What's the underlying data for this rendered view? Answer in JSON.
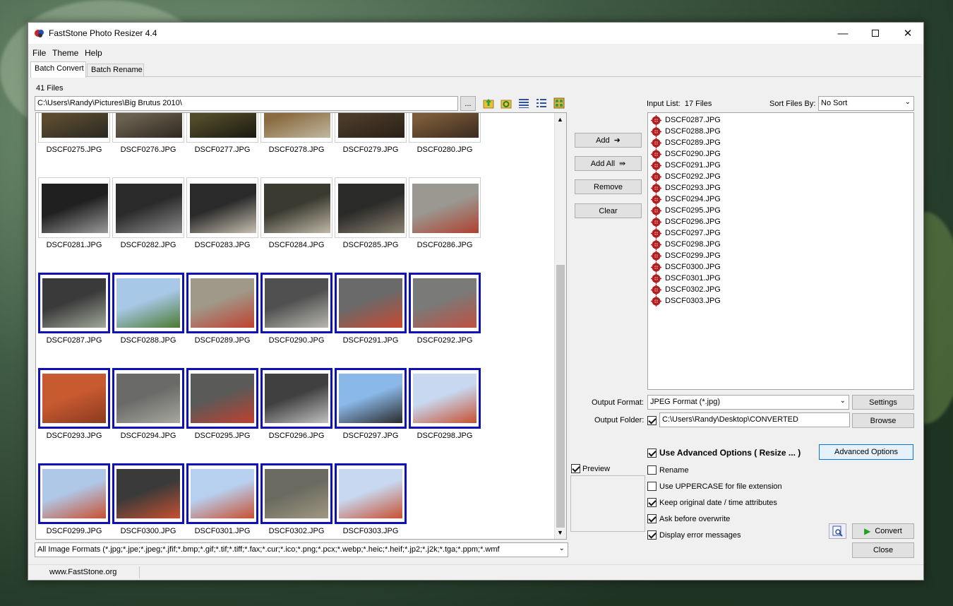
{
  "window": {
    "title": "FastStone Photo Resizer 4.4"
  },
  "menu": [
    "File",
    "Theme",
    "Help"
  ],
  "tabs": [
    "Batch Convert",
    "Batch Rename"
  ],
  "browser": {
    "file_count": "41 Files",
    "path": "C:\\Users\\Randy\\Pictures\\Big Brutus 2010\\",
    "browse_label": "...",
    "filter": "All Image Formats (*.jpg;*.jpe;*.jpeg;*.jfif;*.bmp;*.gif;*.tif;*.tiff;*.fax;*.cur;*.ico;*.png;*.pcx;*.webp;*.heic;*.heif;*.jp2;*.j2k;*.tga;*.ppm;*.wmf"
  },
  "thumbnails": [
    {
      "name": "DSCF0275.JPG",
      "selected": false,
      "colors": [
        "#5a4a30",
        "#2a2a20"
      ]
    },
    {
      "name": "DSCF0276.JPG",
      "selected": false,
      "colors": [
        "#6a6050",
        "#302820"
      ]
    },
    {
      "name": "DSCF0277.JPG",
      "selected": false,
      "colors": [
        "#504a2a",
        "#1a1a10"
      ]
    },
    {
      "name": "DSCF0278.JPG",
      "selected": false,
      "colors": [
        "#8a6a40",
        "#c0b8a0"
      ]
    },
    {
      "name": "DSCF0279.JPG",
      "selected": false,
      "colors": [
        "#4a3a28",
        "#2a2018"
      ]
    },
    {
      "name": "DSCF0280.JPG",
      "selected": false,
      "colors": [
        "#7a5a38",
        "#3a2a20"
      ]
    },
    {
      "name": "DSCF0281.JPG",
      "selected": false,
      "colors": [
        "#202020",
        "#9a9a9a"
      ]
    },
    {
      "name": "DSCF0282.JPG",
      "selected": false,
      "colors": [
        "#2a2a2a",
        "#8a8a8a"
      ]
    },
    {
      "name": "DSCF0283.JPG",
      "selected": false,
      "colors": [
        "#2a2a2a",
        "#c8c0b0"
      ]
    },
    {
      "name": "DSCF0284.JPG",
      "selected": false,
      "colors": [
        "#3a3a30",
        "#c0b8a8"
      ]
    },
    {
      "name": "DSCF0285.JPG",
      "selected": false,
      "colors": [
        "#2a2a28",
        "#8a8070"
      ]
    },
    {
      "name": "DSCF0286.JPG",
      "selected": false,
      "colors": [
        "#9a9890",
        "#b04030"
      ]
    },
    {
      "name": "DSCF0287.JPG",
      "selected": true,
      "colors": [
        "#3a3a3a",
        "#a0a898"
      ]
    },
    {
      "name": "DSCF0288.JPG",
      "selected": true,
      "colors": [
        "#a8c8e8",
        "#4a7a30"
      ]
    },
    {
      "name": "DSCF0289.JPG",
      "selected": true,
      "colors": [
        "#a09888",
        "#c04030"
      ]
    },
    {
      "name": "DSCF0290.JPG",
      "selected": true,
      "colors": [
        "#505050",
        "#b8b8b0"
      ]
    },
    {
      "name": "DSCF0291.JPG",
      "selected": true,
      "colors": [
        "#6a6a6a",
        "#c84830"
      ]
    },
    {
      "name": "DSCF0292.JPG",
      "selected": true,
      "colors": [
        "#7a7a78",
        "#c05040"
      ]
    },
    {
      "name": "DSCF0293.JPG",
      "selected": true,
      "colors": [
        "#c85a30",
        "#8a3a20"
      ]
    },
    {
      "name": "DSCF0294.JPG",
      "selected": true,
      "colors": [
        "#6a6a68",
        "#a8a8a0"
      ]
    },
    {
      "name": "DSCF0295.JPG",
      "selected": true,
      "colors": [
        "#5a5a58",
        "#c04030"
      ]
    },
    {
      "name": "DSCF0296.JPG",
      "selected": true,
      "colors": [
        "#404040",
        "#c0c0c0"
      ]
    },
    {
      "name": "DSCF0297.JPG",
      "selected": true,
      "colors": [
        "#8ab8e8",
        "#2a2a2a"
      ]
    },
    {
      "name": "DSCF0298.JPG",
      "selected": true,
      "colors": [
        "#c8d8f0",
        "#c85030"
      ]
    },
    {
      "name": "DSCF0299.JPG",
      "selected": true,
      "colors": [
        "#b0c8e8",
        "#c85030"
      ]
    },
    {
      "name": "DSCF0300.JPG",
      "selected": true,
      "colors": [
        "#3a3a3a",
        "#c85030"
      ]
    },
    {
      "name": "DSCF0301.JPG",
      "selected": true,
      "colors": [
        "#b8d0f0",
        "#c85030"
      ]
    },
    {
      "name": "DSCF0302.JPG",
      "selected": true,
      "colors": [
        "#6a6a60",
        "#a09880"
      ]
    },
    {
      "name": "DSCF0303.JPG",
      "selected": true,
      "colors": [
        "#c8d8f0",
        "#c85030"
      ]
    }
  ],
  "actions": {
    "add": "Add",
    "add_all": "Add All",
    "remove": "Remove",
    "clear": "Clear"
  },
  "input_list": {
    "label": "Input List:",
    "count": "17 Files",
    "sort_label": "Sort Files By:",
    "sort_value": "No Sort",
    "files": [
      "DSCF0287.JPG",
      "DSCF0288.JPG",
      "DSCF0289.JPG",
      "DSCF0290.JPG",
      "DSCF0291.JPG",
      "DSCF0292.JPG",
      "DSCF0293.JPG",
      "DSCF0294.JPG",
      "DSCF0295.JPG",
      "DSCF0296.JPG",
      "DSCF0297.JPG",
      "DSCF0298.JPG",
      "DSCF0299.JPG",
      "DSCF0300.JPG",
      "DSCF0301.JPG",
      "DSCF0302.JPG",
      "DSCF0303.JPG"
    ]
  },
  "output": {
    "format_label": "Output Format:",
    "format_value": "JPEG Format (*.jpg)",
    "settings_label": "Settings",
    "folder_label": "Output Folder:",
    "folder_checked": true,
    "folder_value": "C:\\Users\\Randy\\Desktop\\CONVERTED",
    "browse_label": "Browse"
  },
  "preview": {
    "label": "Preview",
    "checked": true
  },
  "options": {
    "advanced_label": "Use Advanced Options ( Resize ... )",
    "advanced_checked": true,
    "advanced_button": "Advanced Options",
    "items": [
      {
        "label": "Rename",
        "checked": false
      },
      {
        "label": "Use UPPERCASE for file extension",
        "checked": false
      },
      {
        "label": "Keep original date / time attributes",
        "checked": true
      },
      {
        "label": "Ask before overwrite",
        "checked": true
      },
      {
        "label": "Display error messages",
        "checked": true
      }
    ]
  },
  "footer": {
    "convert": "Convert",
    "close": "Close",
    "website": "www.FastStone.org"
  }
}
